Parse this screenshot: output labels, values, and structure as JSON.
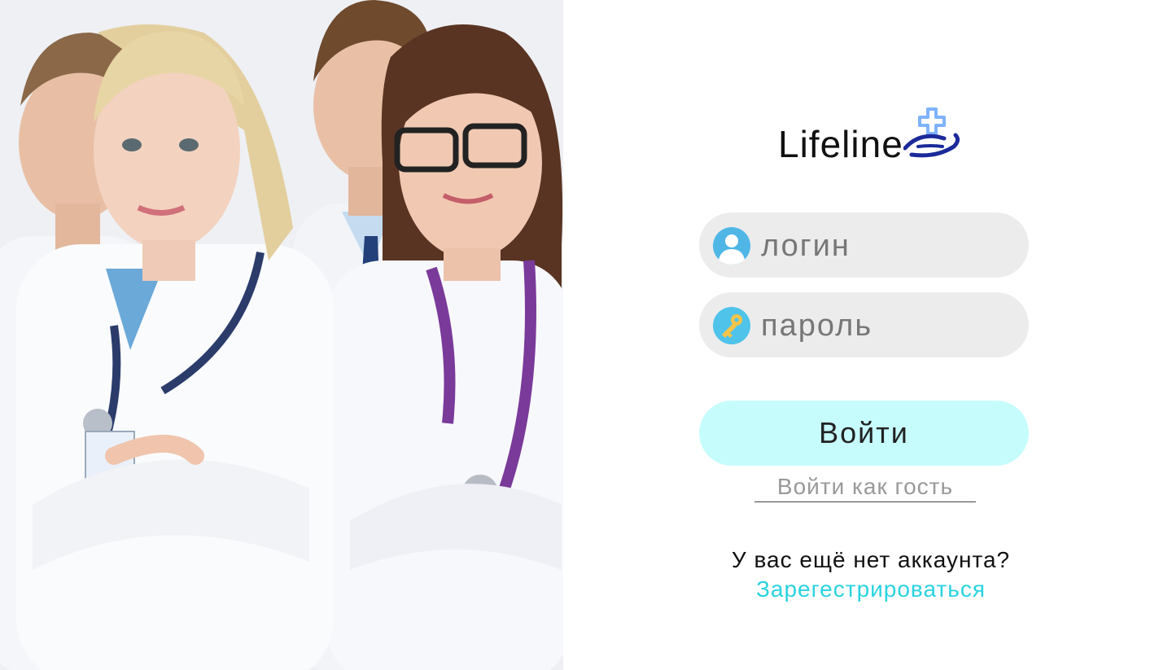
{
  "brand": {
    "name": "Lifeline",
    "text_color": "#111111",
    "cross_color": "#7fb3ff",
    "hand_color": "#1b2a9a"
  },
  "hero_image": {
    "icon": "doctors-photo"
  },
  "login_form": {
    "login_field": {
      "placeholder": "логин",
      "value": "",
      "icon": "user-icon"
    },
    "password_field": {
      "placeholder": "пароль",
      "value": "",
      "icon": "key-icon"
    },
    "submit_label": "Войти",
    "guest_label": "Войти как гость",
    "no_account_text": "У вас ещё нет аккаунта?",
    "register_label": "Зарегестрироваться"
  },
  "colors": {
    "field_bg": "#ececec",
    "button_bg": "#c7fcfd",
    "register_link": "#2ad3e0",
    "guest_link": "#999999"
  }
}
